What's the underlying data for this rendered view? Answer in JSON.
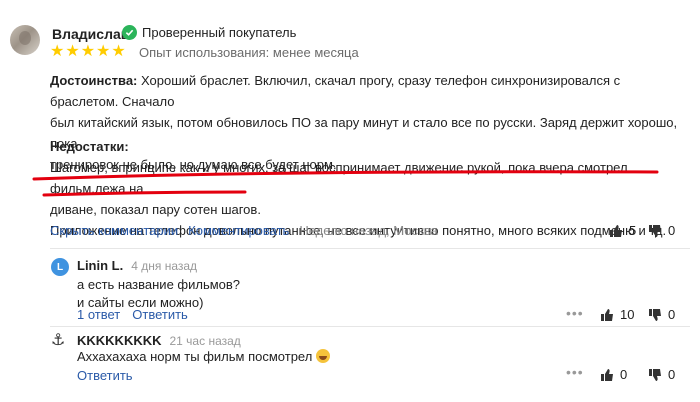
{
  "review": {
    "author": "Владислав",
    "verified_label": "Проверенный покупатель",
    "rating": 5,
    "experience": "Опыт использования: менее месяца",
    "pros_label": "Достоинства:",
    "pros_line1": "Хороший браслет. Включил, скачал прогу, сразу телефон синхронизировался с браслетом. Сначало",
    "pros_line2": "был китайский язык, потом обновилось ПО за пару минут и стало все по русски. Заряд держит хорошо, пока",
    "pros_line3": "тренировок не было, но думаю все будет норм.",
    "cons_label": "Недостатки:",
    "cons_line1": "Шагомер, впринципе как и у многих, за шаг воспринимает движение рукой, пока вчера смотрел фильм,лежа на",
    "cons_line2": "диване, показал пару сотен шагов.",
    "cons_line3": "Приложение на телефон довольно путанное, не все интуитивно понятно, много всяких подменю и тд.",
    "hide_comments": "Скрыть комментарии",
    "comment_action": "Комментировать",
    "meta": "Неделю назад, Москва",
    "likes": "5",
    "dislikes": "0"
  },
  "comments": [
    {
      "avatar_letter": "L",
      "author": "Linin L.",
      "time": "4 дня назад",
      "line1": "а есть название фильмов?",
      "line2": "и сайты если можно)",
      "replies": "1 ответ",
      "reply_label": "Ответить",
      "likes": "10",
      "dislikes": "0"
    },
    {
      "avatar_symbol": "⚓",
      "author": "KKKKKKKKK",
      "time": "21 час назад",
      "line1": "Аххахахаха норм ты фильм посмотрел",
      "reply_label": "Ответить",
      "likes": "0",
      "dislikes": "0"
    }
  ],
  "colors": {
    "link": "#2a5aa8",
    "star": "#ffcc00",
    "verified": "#2bb45a",
    "annotation": "#e3000f"
  },
  "icons": [
    "check-icon",
    "star-icon",
    "thumb-up-icon",
    "thumb-down-icon",
    "more-dots-icon",
    "anchor-icon",
    "laughing-emoji-icon"
  ]
}
